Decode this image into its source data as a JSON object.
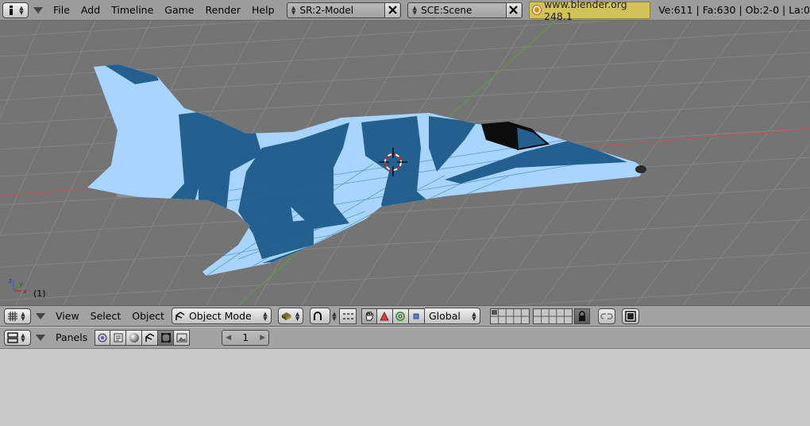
{
  "topbar": {
    "menu": [
      "File",
      "Add",
      "Timeline",
      "Game",
      "Render",
      "Help"
    ],
    "screen_name": "SR:2-Model",
    "scene_name": "SCE:Scene",
    "badge_text": "www.blender.org 248.1",
    "stats": "Ve:611 | Fa:630 | Ob:2-0 | La:0"
  },
  "viewport": {
    "frame_label": "(1)",
    "axis_labels": {
      "x": "x",
      "y": "y",
      "z": "z"
    },
    "colors": {
      "grid": "#8a8a8a",
      "background": "#747474",
      "camo_light": "#a7d5ff",
      "camo_dark": "#23608f",
      "x_axis": "#b34a4a",
      "y_axis": "#5c9b3a"
    }
  },
  "view3d_header": {
    "menu": [
      "View",
      "Select",
      "Object"
    ],
    "mode": "Object Mode",
    "orientation": "Global"
  },
  "buttons_header": {
    "menu_label": "Panels",
    "frame_value": "1"
  }
}
